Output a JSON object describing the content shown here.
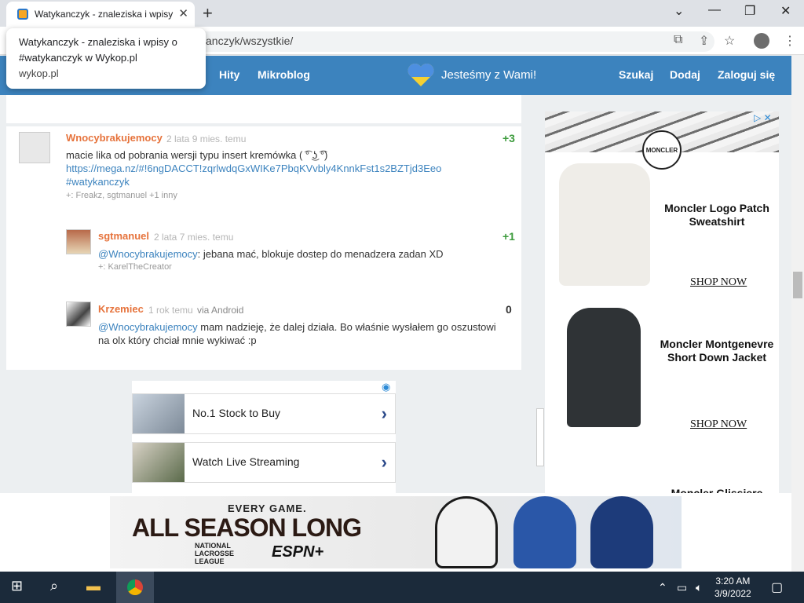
{
  "browser": {
    "tab_title": "Watykanczyk - znaleziska i wpisy",
    "new_tab": "+",
    "close_tab": "✕",
    "url": "anczyk/wszystkie/",
    "tooltip": {
      "line1": "Watykanczyk - znaleziska i wpisy o",
      "line2": "#watykanczyk w Wykop.pl",
      "host": "wykop.pl"
    }
  },
  "site_nav": {
    "hity": "Hity",
    "mikroblog": "Mikroblog",
    "solidarity": "Jesteśmy z Wami!",
    "szukaj": "Szukaj",
    "dodaj": "Dodaj",
    "zaloguj": "Zaloguj się"
  },
  "entries": [
    {
      "author": "Wnocybrakujemocy",
      "meta": "2 lata 9 mies. temu",
      "score": "+3",
      "text": "macie lika od pobrania wersji typu insert kremówka ( ͡° ͜ʖ ͡°)",
      "link": "https://mega.nz/#!6ngDACCT!zqrlwdqGxWIKe7PbqKVvbly4KnnkFst1s2BZTjd3Eeo",
      "tag": "#watykanczyk",
      "voters": "+: Freakz, sgtmanuel +1 inny"
    },
    {
      "author": "sgtmanuel",
      "meta": "2 lata 7 mies. temu",
      "score": "+1",
      "mention": "@Wnocybrakujemocy",
      "text": ": jebana mać, blokuje dostep do menadzera zadan XD",
      "voters": "+: KarelTheCreator"
    },
    {
      "author": "Krzemiec",
      "meta": "1 rok temu",
      "via": "via Android",
      "score": "0",
      "mention": "@Wnocybrakujemocy",
      "text": " mam nadzieję, że dalej działa. Bo właśnie wysłałem go oszustowi",
      "text2": "na olx który chciał mnie wykiwać :p"
    }
  ],
  "ads": {
    "row1": "No.1 Stock to Buy",
    "row2": "Watch Live Streaming",
    "chevron": "›",
    "right": {
      "logo": "MONCLER",
      "product1": "Moncler Logo Patch Sweatshirt",
      "product2": "Moncler Montgenevre Short Down Jacket",
      "product3": "Moncler Glissiere",
      "shop": "SHOP NOW",
      "adchoices": "▷ ✕"
    },
    "banner": {
      "line1": "EVERY GAME.",
      "line2": "ALL SEASON LONG",
      "league": "NATIONAL LACROSSE LEAGUE",
      "network": "ESPN+"
    }
  },
  "taskbar": {
    "time": "3:20 AM",
    "date": "3/9/2022"
  },
  "colors": {
    "wykop_blue": "#3c83be",
    "author_orange": "#e6733c",
    "score_green": "#3c9b3c"
  }
}
